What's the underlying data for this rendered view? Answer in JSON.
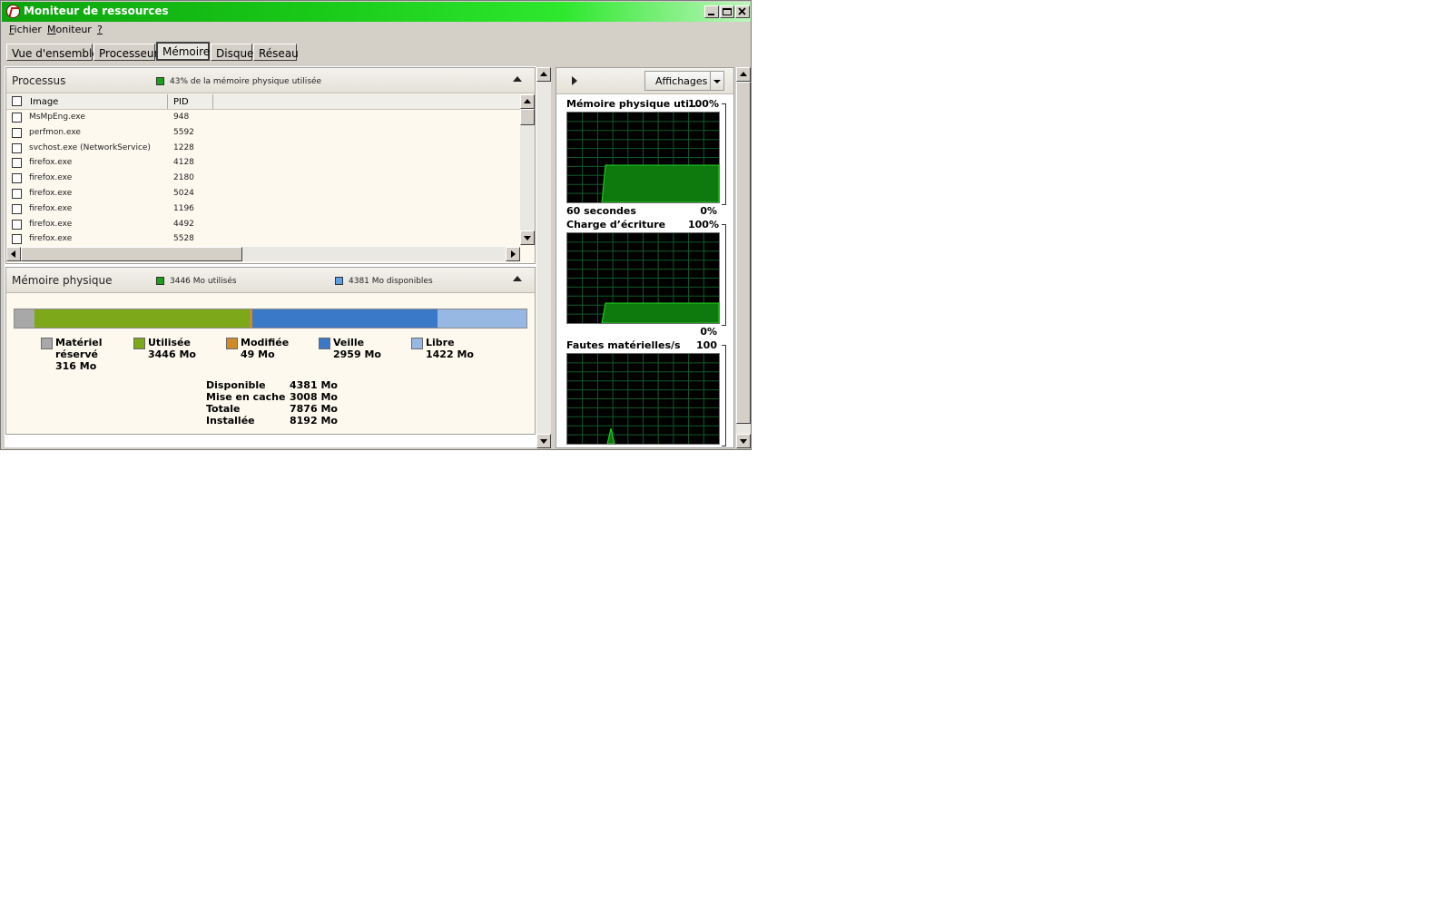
{
  "window": {
    "title": "Moniteur de ressources"
  },
  "menu": [
    {
      "label": "Fichier",
      "underline": "F",
      "rest": "ichier"
    },
    {
      "label": "Moniteur",
      "underline": "M",
      "rest": "oniteur"
    },
    {
      "label": "?",
      "underline": "?",
      "rest": ""
    }
  ],
  "tabs": [
    {
      "label": "Vue d'ensemble",
      "active": false
    },
    {
      "label": "Processeur",
      "active": false
    },
    {
      "label": "Mémoire",
      "active": true
    },
    {
      "label": "Disque",
      "active": false
    },
    {
      "label": "Réseau",
      "active": false
    }
  ],
  "processes": {
    "title": "Processus",
    "usage_text": "43% de la mémoire physique utilisée",
    "columns": [
      "Image",
      "PID"
    ],
    "rows": [
      {
        "image": "MsMpEng.exe",
        "pid": "948"
      },
      {
        "image": "perfmon.exe",
        "pid": "5592"
      },
      {
        "image": "svchost.exe (NetworkService)",
        "pid": "1228"
      },
      {
        "image": "firefox.exe",
        "pid": "4128"
      },
      {
        "image": "firefox.exe",
        "pid": "2180"
      },
      {
        "image": "firefox.exe",
        "pid": "5024"
      },
      {
        "image": "firefox.exe",
        "pid": "1196"
      },
      {
        "image": "firefox.exe",
        "pid": "4492"
      },
      {
        "image": "firefox.exe",
        "pid": "5528"
      }
    ]
  },
  "physical_memory": {
    "title": "Mémoire physique",
    "used_text": "3446 Mo utilisés",
    "available_text": "4381 Mo disponibles",
    "bar_total_mo": 8192,
    "segments": [
      {
        "name": "Matériel réservé",
        "label_lines": [
          "Matériel",
          "réservé"
        ],
        "value": "316 Mo",
        "mo": 316,
        "color": "#a8a8a8"
      },
      {
        "name": "Utilisée",
        "label_lines": [
          "Utilisée"
        ],
        "value": "3446 Mo",
        "mo": 3446,
        "color": "#7da81a"
      },
      {
        "name": "Modifiée",
        "label_lines": [
          "Modifiée"
        ],
        "value": "49 Mo",
        "mo": 49,
        "color": "#d08a2a"
      },
      {
        "name": "Veille",
        "label_lines": [
          "Veille"
        ],
        "value": "2959 Mo",
        "mo": 2959,
        "color": "#3a78c8"
      },
      {
        "name": "Libre",
        "label_lines": [
          "Libre"
        ],
        "value": "1422 Mo",
        "mo": 1422,
        "color": "#98b8e4"
      }
    ],
    "stats": [
      {
        "label": "Disponible",
        "value": "4381 Mo"
      },
      {
        "label": "Mise en cache",
        "value": "3008 Mo"
      },
      {
        "label": "Totale",
        "value": "7876 Mo"
      },
      {
        "label": "Installée",
        "value": "8192 Mo"
      }
    ]
  },
  "right_panel": {
    "views_button": "Affichages",
    "graphs": [
      {
        "title": "Mémoire physique uti...",
        "max": "100%",
        "bottom_left": "60 secondes",
        "bottom_right": "0%",
        "trace": "step_high"
      },
      {
        "title": "Charge d’écriture",
        "max": "100%",
        "bottom_left": "",
        "bottom_right": "0%",
        "trace": "step_low"
      },
      {
        "title": "Fautes matérielles/s",
        "max": "100",
        "bottom_left": "",
        "bottom_right": "",
        "trace": "spike"
      }
    ]
  },
  "colors": {
    "used_legend": "#1aa01a",
    "available_legend": "#3a78c8",
    "graph_line": "#22d422",
    "graph_fill": "#0e7a0e"
  }
}
